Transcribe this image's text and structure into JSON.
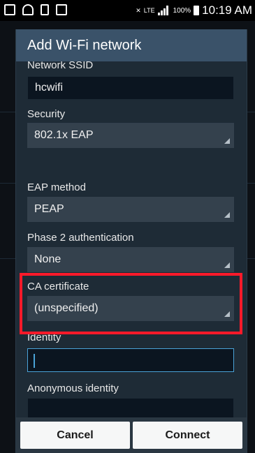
{
  "status_bar": {
    "time": "10:19 AM",
    "battery_percent": "100%",
    "network": "LTE",
    "icons": [
      "notification-icon",
      "wifi-icon",
      "sd-card-icon",
      "gallery-icon",
      "mute-icon",
      "signal-icon",
      "battery-icon"
    ]
  },
  "dialog": {
    "title": "Add Wi-Fi network",
    "fields": {
      "ssid": {
        "label": "Network SSID",
        "value": "hcwifi"
      },
      "security": {
        "label": "Security",
        "value": "802.1x EAP"
      },
      "eap_method": {
        "label": "EAP method",
        "value": "PEAP"
      },
      "phase2": {
        "label": "Phase 2 authentication",
        "value": "None"
      },
      "ca_cert": {
        "label": "CA certificate",
        "value": "(unspecified)"
      },
      "identity": {
        "label": "Identity",
        "value": ""
      },
      "anonymous_identity": {
        "label": "Anonymous identity",
        "value": ""
      }
    },
    "buttons": {
      "cancel": "Cancel",
      "connect": "Connect"
    }
  },
  "colors": {
    "dialog_title_bg": "#3a5269",
    "dialog_bg": "#1e2b36",
    "highlight_border": "#ff1a2a",
    "accent": "#4aa3d8"
  }
}
